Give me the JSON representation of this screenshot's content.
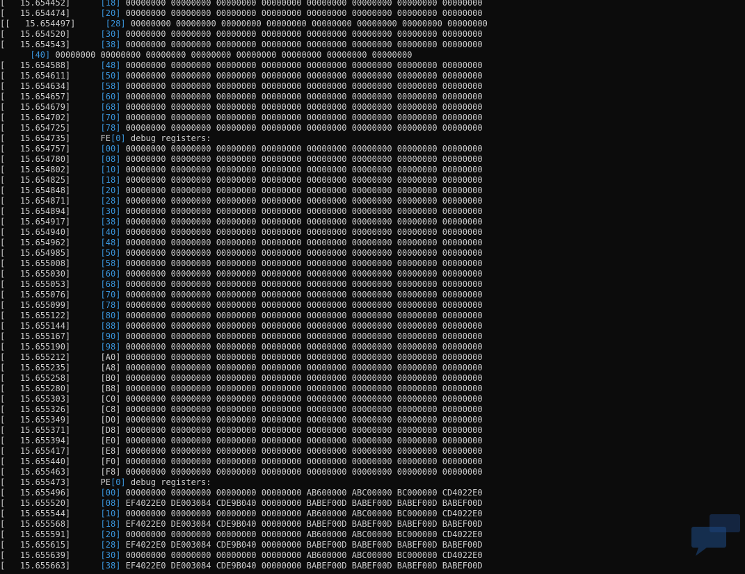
{
  "terminal": {
    "background": "#0c0c0c",
    "text_color": "#cccccc",
    "offset_color": "#3a96dd",
    "lines": [
      {
        "ts": "[   15.654452]",
        "off": "[18]",
        "hl": true,
        "rest": " 00000000 00000000 00000000 00000000 00000000 00000000 00000000 00000000"
      },
      {
        "ts": "[   15.654474]",
        "off": "[20]",
        "hl": true,
        "rest": " 00000000 00000000 00000000 00000000 00000000 00000000 00000000 00000000"
      },
      {
        "ts": "[[   15.654497]",
        "off": "[28]",
        "hl": true,
        "rest": " 00000000 00000000 00000000 00000000 00000000 00000000 00000000 00000000",
        "indent": 1
      },
      {
        "ts": "[   15.654520]",
        "off": "[30]",
        "hl": true,
        "rest": " 00000000 00000000 00000000 00000000 00000000 00000000 00000000 00000000"
      },
      {
        "ts": "[   15.654543]",
        "off": "[38]",
        "hl": true,
        "rest": " 00000000 00000000 00000000 00000000 00000000 00000000 00000000 00000000"
      },
      {
        "ts": "     ",
        "off": "[40]",
        "hl": true,
        "rest": " 00000000 00000000 00000000 00000000 00000000 00000000 00000000 00000000",
        "wrap": true
      },
      {
        "ts": "[   15.654588]",
        "off": "[48]",
        "hl": true,
        "rest": " 00000000 00000000 00000000 00000000 00000000 00000000 00000000 00000000"
      },
      {
        "ts": "[   15.654611]",
        "off": "[50]",
        "hl": true,
        "rest": " 00000000 00000000 00000000 00000000 00000000 00000000 00000000 00000000"
      },
      {
        "ts": "[   15.654634]",
        "off": "[58]",
        "hl": true,
        "rest": " 00000000 00000000 00000000 00000000 00000000 00000000 00000000 00000000"
      },
      {
        "ts": "[   15.654657]",
        "off": "[60]",
        "hl": true,
        "rest": " 00000000 00000000 00000000 00000000 00000000 00000000 00000000 00000000"
      },
      {
        "ts": "[   15.654679]",
        "off": "[68]",
        "hl": true,
        "rest": " 00000000 00000000 00000000 00000000 00000000 00000000 00000000 00000000"
      },
      {
        "ts": "[   15.654702]",
        "off": "[70]",
        "hl": true,
        "rest": " 00000000 00000000 00000000 00000000 00000000 00000000 00000000 00000000"
      },
      {
        "ts": "[   15.654725]",
        "off": "[78]",
        "hl": true,
        "rest": " 00000000 00000000 00000000 00000000 00000000 00000000 00000000 00000000"
      },
      {
        "ts": "[   15.654735]",
        "pre": "FE",
        "off": "[0]",
        "hl": true,
        "rest": " debug registers:"
      },
      {
        "ts": "[   15.654757]",
        "off": "[00]",
        "hl": true,
        "rest": " 00000000 00000000 00000000 00000000 00000000 00000000 00000000 00000000"
      },
      {
        "ts": "[   15.654780]",
        "off": "[08]",
        "hl": true,
        "rest": " 00000000 00000000 00000000 00000000 00000000 00000000 00000000 00000000"
      },
      {
        "ts": "[   15.654802]",
        "off": "[10]",
        "hl": true,
        "rest": " 00000000 00000000 00000000 00000000 00000000 00000000 00000000 00000000"
      },
      {
        "ts": "[   15.654825]",
        "off": "[18]",
        "hl": true,
        "rest": " 00000000 00000000 00000000 00000000 00000000 00000000 00000000 00000000"
      },
      {
        "ts": "[   15.654848]",
        "off": "[20]",
        "hl": true,
        "rest": " 00000000 00000000 00000000 00000000 00000000 00000000 00000000 00000000"
      },
      {
        "ts": "[   15.654871]",
        "off": "[28]",
        "hl": true,
        "rest": " 00000000 00000000 00000000 00000000 00000000 00000000 00000000 00000000"
      },
      {
        "ts": "[   15.654894]",
        "off": "[30]",
        "hl": true,
        "rest": " 00000000 00000000 00000000 00000000 00000000 00000000 00000000 00000000"
      },
      {
        "ts": "[   15.654917]",
        "off": "[38]",
        "hl": true,
        "rest": " 00000000 00000000 00000000 00000000 00000000 00000000 00000000 00000000"
      },
      {
        "ts": "[   15.654940]",
        "off": "[40]",
        "hl": true,
        "rest": " 00000000 00000000 00000000 00000000 00000000 00000000 00000000 00000000"
      },
      {
        "ts": "[   15.654962]",
        "off": "[48]",
        "hl": true,
        "rest": " 00000000 00000000 00000000 00000000 00000000 00000000 00000000 00000000"
      },
      {
        "ts": "[   15.654985]",
        "off": "[50]",
        "hl": true,
        "rest": " 00000000 00000000 00000000 00000000 00000000 00000000 00000000 00000000"
      },
      {
        "ts": "[   15.655008]",
        "off": "[58]",
        "hl": true,
        "rest": " 00000000 00000000 00000000 00000000 00000000 00000000 00000000 00000000"
      },
      {
        "ts": "[   15.655030]",
        "off": "[60]",
        "hl": true,
        "rest": " 00000000 00000000 00000000 00000000 00000000 00000000 00000000 00000000"
      },
      {
        "ts": "[   15.655053]",
        "off": "[68]",
        "hl": true,
        "rest": " 00000000 00000000 00000000 00000000 00000000 00000000 00000000 00000000"
      },
      {
        "ts": "[   15.655076]",
        "off": "[70]",
        "hl": true,
        "rest": " 00000000 00000000 00000000 00000000 00000000 00000000 00000000 00000000"
      },
      {
        "ts": "[   15.655099]",
        "off": "[78]",
        "hl": true,
        "rest": " 00000000 00000000 00000000 00000000 00000000 00000000 00000000 00000000"
      },
      {
        "ts": "[   15.655122]",
        "off": "[80]",
        "hl": true,
        "rest": " 00000000 00000000 00000000 00000000 00000000 00000000 00000000 00000000"
      },
      {
        "ts": "[   15.655144]",
        "off": "[88]",
        "hl": true,
        "rest": " 00000000 00000000 00000000 00000000 00000000 00000000 00000000 00000000"
      },
      {
        "ts": "[   15.655167]",
        "off": "[90]",
        "hl": true,
        "rest": " 00000000 00000000 00000000 00000000 00000000 00000000 00000000 00000000"
      },
      {
        "ts": "[   15.655190]",
        "off": "[98]",
        "hl": true,
        "rest": " 00000000 00000000 00000000 00000000 00000000 00000000 00000000 00000000"
      },
      {
        "ts": "[   15.655212]",
        "off": "[A0]",
        "hl": false,
        "rest": " 00000000 00000000 00000000 00000000 00000000 00000000 00000000 00000000"
      },
      {
        "ts": "[   15.655235]",
        "off": "[A8]",
        "hl": false,
        "rest": " 00000000 00000000 00000000 00000000 00000000 00000000 00000000 00000000"
      },
      {
        "ts": "[   15.655258]",
        "off": "[B0]",
        "hl": false,
        "rest": " 00000000 00000000 00000000 00000000 00000000 00000000 00000000 00000000"
      },
      {
        "ts": "[   15.655280]",
        "off": "[B8]",
        "hl": false,
        "rest": " 00000000 00000000 00000000 00000000 00000000 00000000 00000000 00000000"
      },
      {
        "ts": "[   15.655303]",
        "off": "[C0]",
        "hl": false,
        "rest": " 00000000 00000000 00000000 00000000 00000000 00000000 00000000 00000000"
      },
      {
        "ts": "[   15.655326]",
        "off": "[C8]",
        "hl": false,
        "rest": " 00000000 00000000 00000000 00000000 00000000 00000000 00000000 00000000"
      },
      {
        "ts": "[   15.655349]",
        "off": "[D0]",
        "hl": false,
        "rest": " 00000000 00000000 00000000 00000000 00000000 00000000 00000000 00000000"
      },
      {
        "ts": "[   15.655371]",
        "off": "[D8]",
        "hl": false,
        "rest": " 00000000 00000000 00000000 00000000 00000000 00000000 00000000 00000000"
      },
      {
        "ts": "[   15.655394]",
        "off": "[E0]",
        "hl": false,
        "rest": " 00000000 00000000 00000000 00000000 00000000 00000000 00000000 00000000"
      },
      {
        "ts": "[   15.655417]",
        "off": "[E8]",
        "hl": false,
        "rest": " 00000000 00000000 00000000 00000000 00000000 00000000 00000000 00000000"
      },
      {
        "ts": "[   15.655440]",
        "off": "[F0]",
        "hl": false,
        "rest": " 00000000 00000000 00000000 00000000 00000000 00000000 00000000 00000000"
      },
      {
        "ts": "[   15.655463]",
        "off": "[F8]",
        "hl": false,
        "rest": " 00000000 00000000 00000000 00000000 00000000 00000000 00000000 00000000"
      },
      {
        "ts": "[   15.655473]",
        "pre": "PE",
        "off": "[0]",
        "hl": true,
        "rest": " debug registers:"
      },
      {
        "ts": "[   15.655496]",
        "off": "[00]",
        "hl": true,
        "rest": " 00000000 00000000 00000000 00000000 AB600000 ABC00000 BC000000 CD4022E0"
      },
      {
        "ts": "[   15.655520]",
        "off": "[08]",
        "hl": true,
        "rest": " EF4022E0 DE003084 CDE9B040 00000000 BABEF00D BABEF00D BABEF00D BABEF00D"
      },
      {
        "ts": "[   15.655544]",
        "off": "[10]",
        "hl": true,
        "rest": " 00000000 00000000 00000000 00000000 AB600000 ABC00000 BC000000 CD4022E0"
      },
      {
        "ts": "[   15.655568]",
        "off": "[18]",
        "hl": true,
        "rest": " EF4022E0 DE003084 CDE9B040 00000000 BABEF00D BABEF00D BABEF00D BABEF00D"
      },
      {
        "ts": "[   15.655591]",
        "off": "[20]",
        "hl": true,
        "rest": " 00000000 00000000 00000000 00000000 AB600000 ABC00000 BC000000 CD4022E0"
      },
      {
        "ts": "[   15.655615]",
        "off": "[28]",
        "hl": true,
        "rest": " EF4022E0 DE003084 CDE9B040 00000000 BABEF00D BABEF00D BABEF00D BABEF00D"
      },
      {
        "ts": "[   15.655639]",
        "off": "[30]",
        "hl": true,
        "rest": " 00000000 00000000 00000000 00000000 AB600000 ABC00000 BC000000 CD4022E0"
      },
      {
        "ts": "[   15.655663]",
        "off": "[38]",
        "hl": true,
        "rest": " EF4022E0 DE003084 CDE9B040 00000000 BABEF00D BABEF00D BABEF00D BABEF00D"
      }
    ]
  }
}
